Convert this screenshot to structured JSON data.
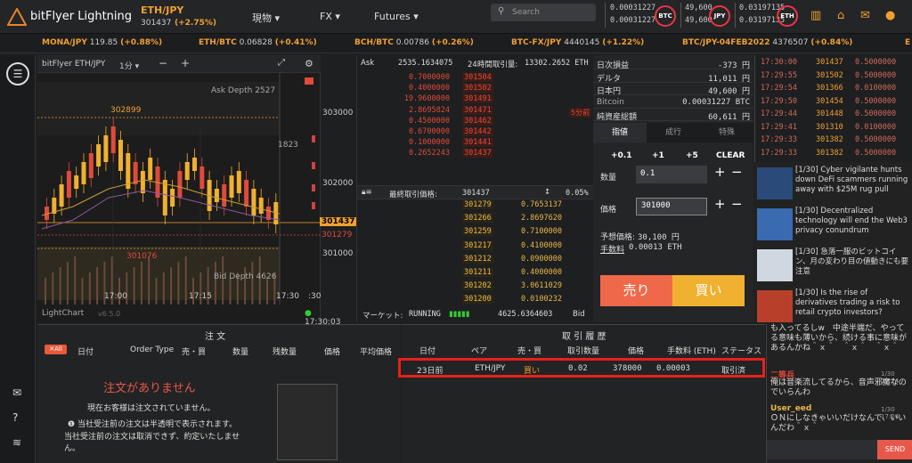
{
  "brand": {
    "name": "bitFlyer Lightning",
    "pair": "ETH/JPY",
    "price": "301437",
    "change": "(+2.75%)"
  },
  "nav": {
    "spot": "現物",
    "fx": "FX",
    "futures": "Futures"
  },
  "search": {
    "placeholder": "Search"
  },
  "rates": {
    "btc_top": "0.00031227",
    "btc_bot": "0.00031227",
    "btc": "BTC",
    "jpy_top": "49,600",
    "jpy_bot": "49,600",
    "jpy": "JPY",
    "eth_top": "0.03197135",
    "eth_bot": "0.03197135",
    "eth": "ETH"
  },
  "ticker": [
    {
      "pair": "MONA/JPY",
      "value": "119.85",
      "change": "(+0.88%)"
    },
    {
      "pair": "ETH/BTC",
      "value": "0.06828",
      "change": "(+0.41%)"
    },
    {
      "pair": "BCH/BTC",
      "value": "0.00786",
      "change": "(+0.26%)"
    },
    {
      "pair": "BTC-FX/JPY",
      "value": "4440145",
      "change": "(+1.22%)"
    },
    {
      "pair": "BTC/JPY-04FEB2022",
      "value": "4376507",
      "change": "(+0.84%)"
    },
    {
      "pair": "E",
      "value": "",
      "change": ""
    }
  ],
  "chart": {
    "pair": "bitFlyer ETH/JPY",
    "interval": "1分",
    "ask_depth": "Ask Depth 2527",
    "bid_depth": "Bid Depth 4626",
    "high": "302899",
    "low": "301076",
    "mid": "1823",
    "current": "301437",
    "line2": "301279",
    "y1": "303000",
    "y2": "302000",
    "y3": "301000",
    "t1": "17:00",
    "t2": "17:15",
    "t3": "17:30",
    "t4": ":30",
    "footer": "LightChart",
    "version": "v6.5.0",
    "clock": "17:30:03"
  },
  "orderbook": {
    "ask_label": "Ask",
    "ask_price": "2535.1634075",
    "vol_label": "24時間取引量:",
    "vol": "13302.2652 ETH",
    "asks": [
      [
        "0.7000000",
        "301504"
      ],
      [
        "0.4000000",
        "301502"
      ],
      [
        "19.9600000",
        "301491"
      ],
      [
        "2.8695824",
        "301471"
      ],
      [
        "0.4500000",
        "301462"
      ],
      [
        "0.6700000",
        "301442"
      ],
      [
        "0.1000000",
        "301441"
      ],
      [
        "0.2652243",
        "301437"
      ]
    ],
    "last_label": "最終取引価格:",
    "last": "301437",
    "spread": "0.05%",
    "five_min": "5分前",
    "bids": [
      [
        "301279",
        "0.7653137"
      ],
      [
        "301266",
        "2.8697620"
      ],
      [
        "301259",
        "0.7100000"
      ],
      [
        "301217",
        "0.4100000"
      ],
      [
        "301212",
        "0.0900000"
      ],
      [
        "301211",
        "0.4000000"
      ],
      [
        "301202",
        "3.0611029"
      ],
      [
        "301200",
        "0.0100232"
      ]
    ],
    "market_label": "マーケット:",
    "market": "RUNNING",
    "bid_total": "4625.6364603",
    "bid_label": "Bid"
  },
  "account": [
    [
      "日次損益",
      "-373 円"
    ],
    [
      "デルタ",
      "11,011 円"
    ],
    [
      "日本円",
      "49,600 円"
    ],
    [
      "Bitcoin",
      "0.00031227 BTC"
    ],
    [
      "純資産総額",
      "60,611 円"
    ]
  ],
  "order": {
    "tabs": [
      "指値",
      "成行",
      "特殊"
    ],
    "inc": [
      "+0.1",
      "+1",
      "+5",
      "CLEAR"
    ],
    "qty_label": "数量",
    "qty": "0.1",
    "price_label": "価格",
    "price": "301000",
    "est_label": "予想価格:",
    "est": "30,100 円",
    "fee_label": "手数料",
    "fee": "0.00013 ETH",
    "sell": "売り",
    "buy": "買い"
  },
  "trades": [
    [
      "17:30:00",
      "301437",
      "0.5000000"
    ],
    [
      "17:29:55",
      "301502",
      "0.5000000"
    ],
    [
      "17:29:54",
      "301366",
      "0.0100000"
    ],
    [
      "17:29:50",
      "301454",
      "0.5000000"
    ],
    [
      "17:29:44",
      "301448",
      "0.5000000"
    ],
    [
      "17:29:41",
      "301310",
      "0.0100000"
    ],
    [
      "17:29:33",
      "301382",
      "0.5000000"
    ],
    [
      "17:29:33",
      "301382",
      "0.5000000"
    ]
  ],
  "news": [
    {
      "text": "[1/30] Cyber vigilante hunts down DeFi scammers running away with $25M rug pull"
    },
    {
      "text": "[1/30] Decentralized technology will end the Web3 privacy conundrum"
    },
    {
      "text": "[1/30] 急落一服のビットコイン、月の変わり目の値動きにも要注意"
    },
    {
      "text": "[1/30] Is the rise of derivatives trading a risk to retail crypto investors?"
    }
  ],
  "orders": {
    "title": "注 文",
    "all": "All",
    "cols": [
      "日付",
      "Order Type",
      "売・買",
      "数量",
      "残数量",
      "価格",
      "平均価格"
    ],
    "empty": "注文がありません",
    "note1": "現在お客様は注文されていません。",
    "note2": "当社受注前の注文は半透明で表示されます。",
    "note3": "当社受注前の注文は取消できず、約定いたしません。"
  },
  "history": {
    "title": "取 引 履 歴",
    "cols": [
      "日付",
      "ペア",
      "売・買",
      "取引数量",
      "価格",
      "手数料 (ETH)",
      "ステータス"
    ],
    "row": [
      "23日前",
      "ETH/JPY",
      "買い",
      "0.02",
      "378000",
      "0.00003",
      "取引済"
    ]
  },
  "chat": {
    "msg1": "も入ってるしw　中途半端だ、やってる意味も薄いから、続ける事に意味があるんかね＾ｘ＾　＾ｘ＾　＾ｘ＾",
    "user2": "二等兵",
    "time2": "1/30 17:24",
    "msg2": "俺は音楽流してるから、音声邪魔なのでいらんわ",
    "user3": "User_eed",
    "time3": "1/30 17:24",
    "msg3": "ＯＮにしなきゃいいだけなんで、いいんだわ＾ｘ＾",
    "send": "SEND"
  }
}
